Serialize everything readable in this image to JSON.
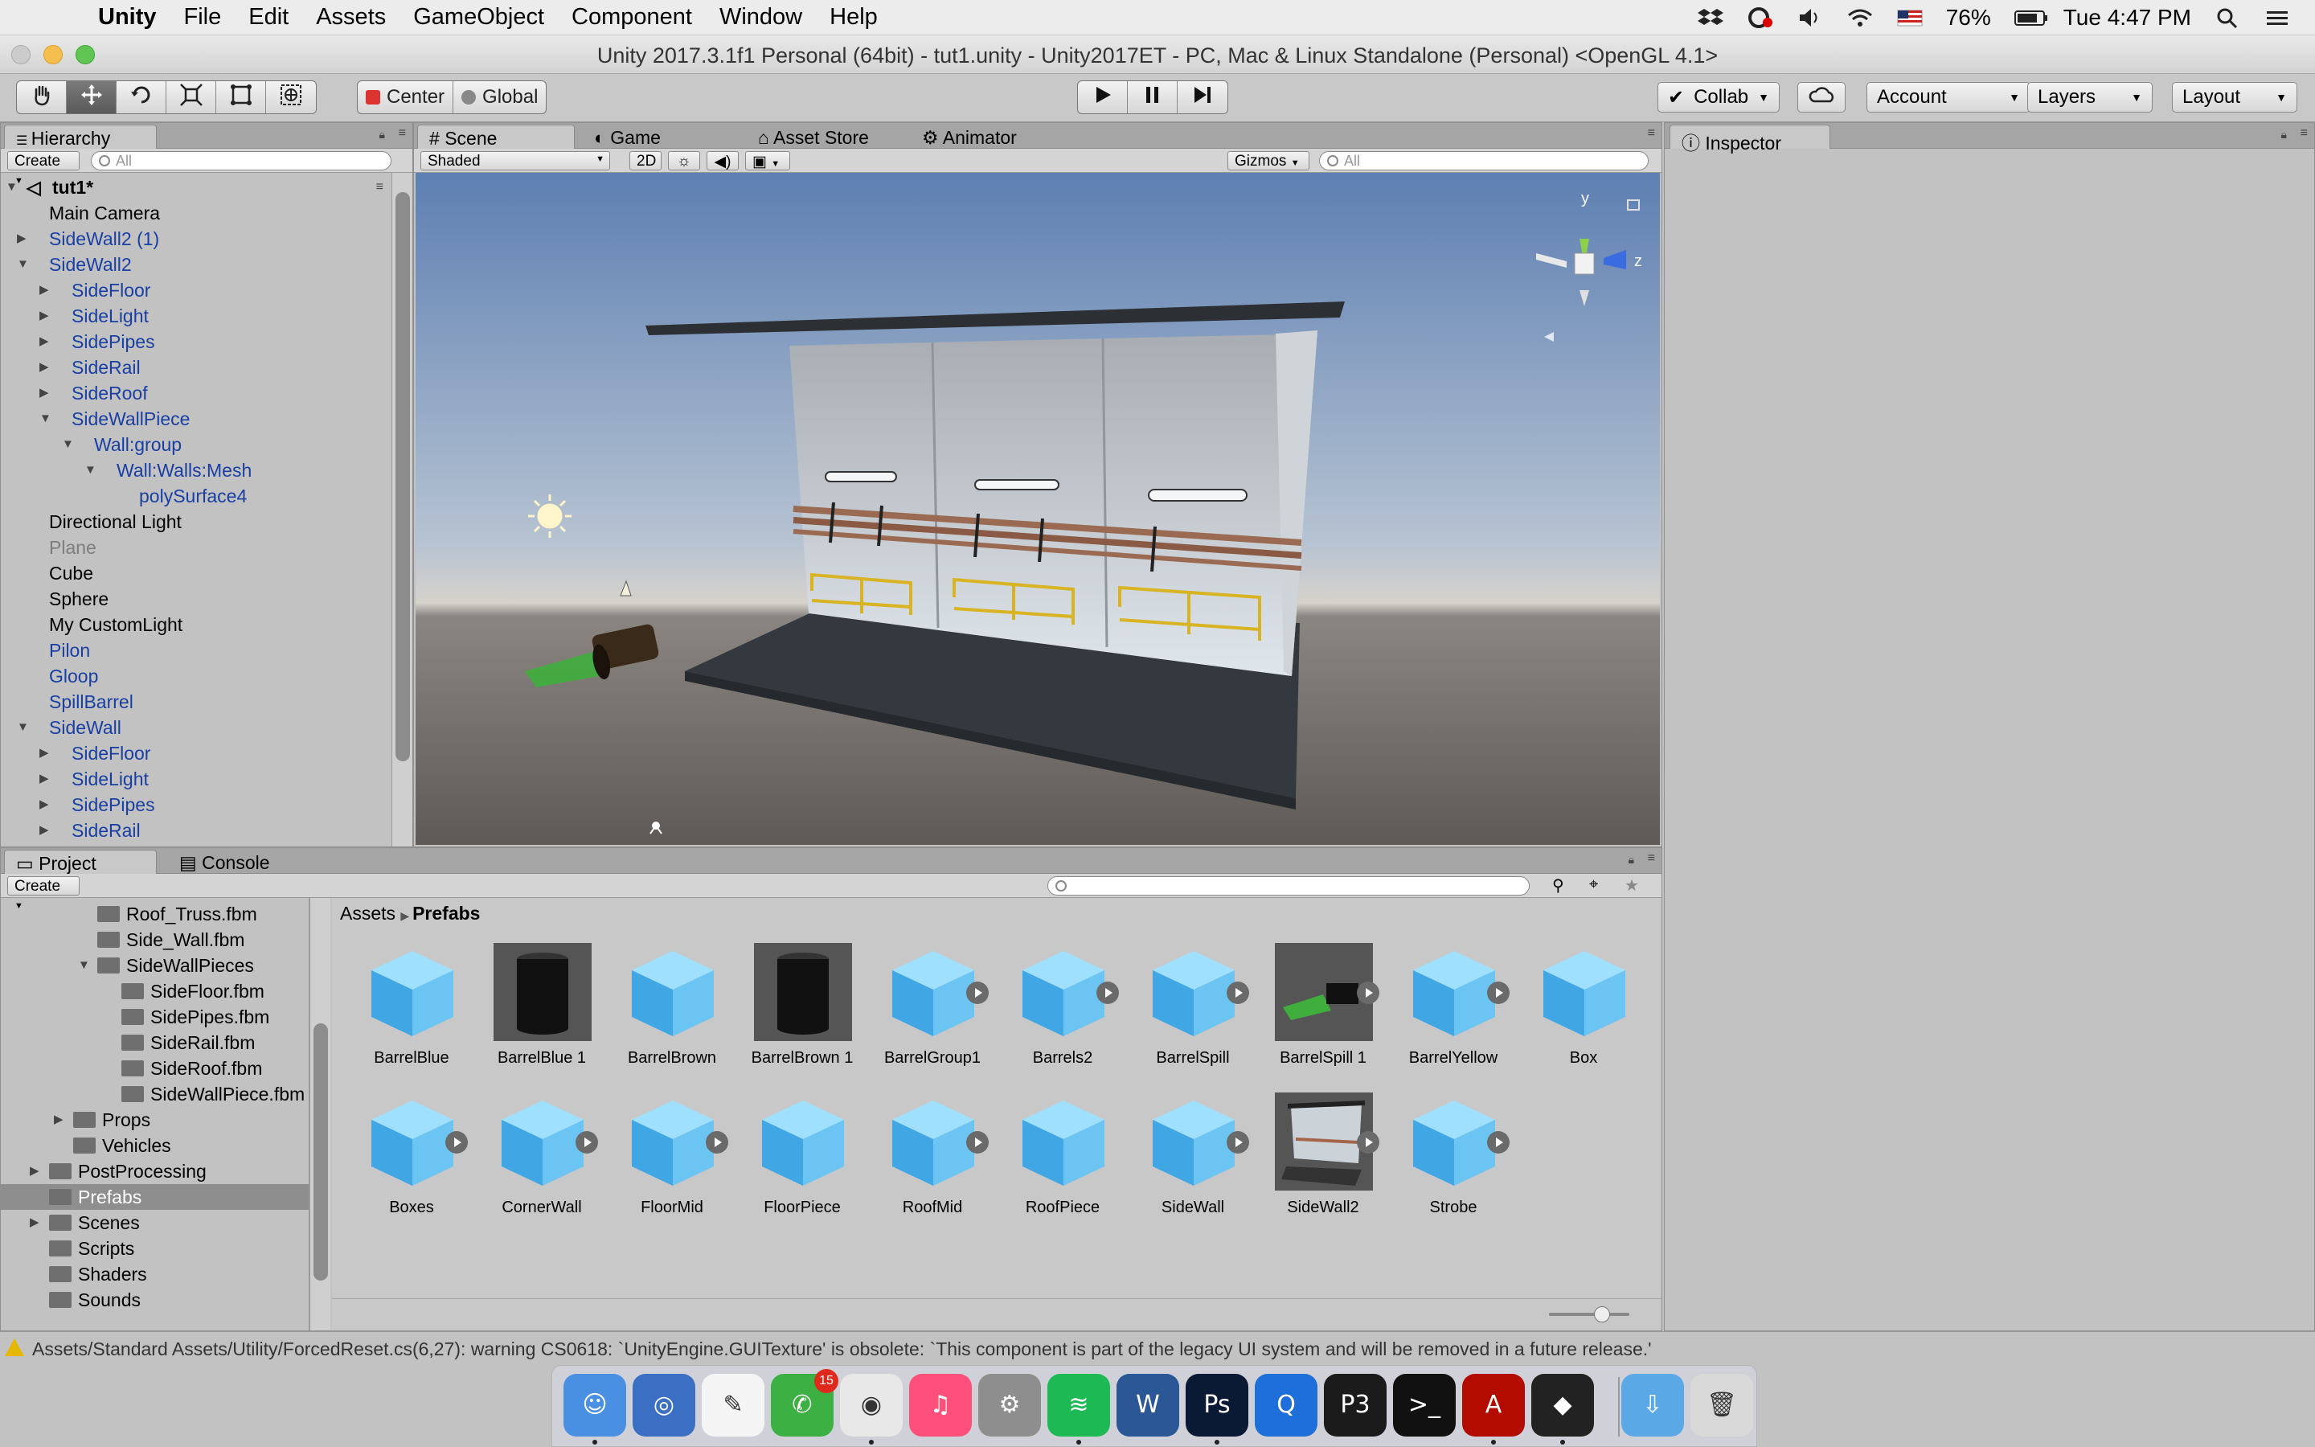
{
  "menubar": {
    "app_name": "Unity",
    "menus": [
      "File",
      "Edit",
      "Assets",
      "GameObject",
      "Component",
      "Window",
      "Help"
    ],
    "battery": "76%",
    "clock": "Tue 4:47 PM"
  },
  "window": {
    "title": "Unity 2017.3.1f1 Personal (64bit) - tut1.unity - Unity2017ET - PC, Mac & Linux Standalone (Personal) <OpenGL 4.1>"
  },
  "toolbar": {
    "pivot_center": "Center",
    "pivot_global": "Global",
    "collab": "Collab",
    "account": "Account",
    "layers": "Layers",
    "layout": "Layout"
  },
  "hierarchy": {
    "tab": "Hierarchy",
    "create": "Create",
    "search_placeholder": "All",
    "scene_name": "tut1*",
    "items": [
      {
        "label": "Main Camera",
        "indent": 0,
        "style": "black",
        "arrow": ""
      },
      {
        "label": "SideWall2 (1)",
        "indent": 0,
        "style": "blue",
        "arrow": "▶"
      },
      {
        "label": "SideWall2",
        "indent": 0,
        "style": "blue",
        "arrow": "▼"
      },
      {
        "label": "SideFloor",
        "indent": 1,
        "style": "blue",
        "arrow": "▶"
      },
      {
        "label": "SideLight",
        "indent": 1,
        "style": "blue",
        "arrow": "▶"
      },
      {
        "label": "SidePipes",
        "indent": 1,
        "style": "blue",
        "arrow": "▶"
      },
      {
        "label": "SideRail",
        "indent": 1,
        "style": "blue",
        "arrow": "▶"
      },
      {
        "label": "SideRoof",
        "indent": 1,
        "style": "blue",
        "arrow": "▶"
      },
      {
        "label": "SideWallPiece",
        "indent": 1,
        "style": "blue",
        "arrow": "▼"
      },
      {
        "label": "Wall:group",
        "indent": 2,
        "style": "blue",
        "arrow": "▼"
      },
      {
        "label": "Wall:Walls:Mesh",
        "indent": 3,
        "style": "blue",
        "arrow": "▼"
      },
      {
        "label": "polySurface4",
        "indent": 4,
        "style": "blue",
        "arrow": ""
      },
      {
        "label": "Directional Light",
        "indent": 0,
        "style": "black",
        "arrow": ""
      },
      {
        "label": "Plane",
        "indent": 0,
        "style": "gray",
        "arrow": ""
      },
      {
        "label": "Cube",
        "indent": 0,
        "style": "black",
        "arrow": ""
      },
      {
        "label": "Sphere",
        "indent": 0,
        "style": "black",
        "arrow": ""
      },
      {
        "label": "My CustomLight",
        "indent": 0,
        "style": "black",
        "arrow": ""
      },
      {
        "label": "Pilon",
        "indent": 0,
        "style": "blue",
        "arrow": ""
      },
      {
        "label": "Gloop",
        "indent": 0,
        "style": "blue",
        "arrow": ""
      },
      {
        "label": "SpillBarrel",
        "indent": 0,
        "style": "blue",
        "arrow": ""
      },
      {
        "label": "SideWall",
        "indent": 0,
        "style": "blue",
        "arrow": "▼"
      },
      {
        "label": "SideFloor",
        "indent": 1,
        "style": "blue",
        "arrow": "▶"
      },
      {
        "label": "SideLight",
        "indent": 1,
        "style": "blue",
        "arrow": "▶"
      },
      {
        "label": "SidePipes",
        "indent": 1,
        "style": "blue",
        "arrow": "▶"
      },
      {
        "label": "SideRail",
        "indent": 1,
        "style": "blue",
        "arrow": "▶"
      }
    ]
  },
  "scene": {
    "tabs": [
      "Scene",
      "Game",
      "Asset Store",
      "Animator"
    ],
    "shading": "Shaded",
    "mode_2d": "2D",
    "gizmos": "Gizmos",
    "search_placeholder": "All",
    "axis_y": "y",
    "axis_z": "z"
  },
  "inspector": {
    "tab": "Inspector"
  },
  "project": {
    "tabs": [
      "Project",
      "Console"
    ],
    "create": "Create",
    "breadcrumb_root": "Assets",
    "breadcrumb_current": "Prefabs",
    "folders": [
      {
        "label": "Roof_Truss.fbm",
        "indent": 3,
        "arrow": ""
      },
      {
        "label": "Side_Wall.fbm",
        "indent": 3,
        "arrow": ""
      },
      {
        "label": "SideWallPieces",
        "indent": 3,
        "arrow": "▼"
      },
      {
        "label": "SideFloor.fbm",
        "indent": 4,
        "arrow": ""
      },
      {
        "label": "SidePipes.fbm",
        "indent": 4,
        "arrow": ""
      },
      {
        "label": "SideRail.fbm",
        "indent": 4,
        "arrow": ""
      },
      {
        "label": "SideRoof.fbm",
        "indent": 4,
        "arrow": ""
      },
      {
        "label": "SideWallPiece.fbm",
        "indent": 4,
        "arrow": ""
      },
      {
        "label": "Props",
        "indent": 2,
        "arrow": "▶"
      },
      {
        "label": "Vehicles",
        "indent": 2,
        "arrow": ""
      },
      {
        "label": "PostProcessing",
        "indent": 1,
        "arrow": "▶"
      },
      {
        "label": "Prefabs",
        "indent": 1,
        "arrow": "",
        "selected": true
      },
      {
        "label": "Scenes",
        "indent": 1,
        "arrow": "▶"
      },
      {
        "label": "Scripts",
        "indent": 1,
        "arrow": ""
      },
      {
        "label": "Shaders",
        "indent": 1,
        "arrow": ""
      },
      {
        "label": "Sounds",
        "indent": 1,
        "arrow": ""
      }
    ],
    "assets": [
      {
        "label": "BarrelBlue",
        "kind": "cube",
        "play": false
      },
      {
        "label": "BarrelBlue 1",
        "kind": "barrel",
        "play": false
      },
      {
        "label": "BarrelBrown",
        "kind": "cube",
        "play": false
      },
      {
        "label": "BarrelBrown 1",
        "kind": "barrel",
        "play": false
      },
      {
        "label": "BarrelGroup1",
        "kind": "cube",
        "play": true
      },
      {
        "label": "Barrels2",
        "kind": "cube",
        "play": true
      },
      {
        "label": "BarrelSpill",
        "kind": "cube",
        "play": true
      },
      {
        "label": "BarrelSpill 1",
        "kind": "spill",
        "play": true
      },
      {
        "label": "BarrelYellow",
        "kind": "cube",
        "play": true
      },
      {
        "label": "Box",
        "kind": "cube",
        "play": false
      },
      {
        "label": "Boxes",
        "kind": "cube",
        "play": true
      },
      {
        "label": "CornerWall",
        "kind": "cube",
        "play": true
      },
      {
        "label": "FloorMid",
        "kind": "cube",
        "play": true
      },
      {
        "label": "FloorPiece",
        "kind": "cube",
        "play": false
      },
      {
        "label": "RoofMid",
        "kind": "cube",
        "play": true
      },
      {
        "label": "RoofPiece",
        "kind": "cube",
        "play": false
      },
      {
        "label": "SideWall",
        "kind": "cube",
        "play": true
      },
      {
        "label": "SideWall2",
        "kind": "wall",
        "play": true
      },
      {
        "label": "Strobe",
        "kind": "cube",
        "play": true
      }
    ]
  },
  "status": {
    "message": "Assets/Standard Assets/Utility/ForcedReset.cs(6,27): warning CS0618: `UnityEngine.GUITexture' is obsolete: `This component is part of the legacy UI system and will be removed in a future release.'"
  },
  "dock": {
    "facetime_badge": "15",
    "apps": [
      "finder-icon",
      "safari-icon",
      "textedit-icon",
      "facetime-icon",
      "chrome-icon",
      "itunes-icon",
      "system-preferences-icon",
      "spotify-icon",
      "word-icon",
      "photoshop-icon",
      "quicktime-icon",
      "p3-icon",
      "terminal-icon",
      "acrobat-icon",
      "unity-icon",
      "downloads-folder-icon",
      "trash-icon"
    ],
    "app_glyphs": [
      "☺",
      "◎",
      "✎",
      "✆",
      "◉",
      "♫",
      "⚙",
      "≋",
      "W",
      "Ps",
      "Q",
      "P3",
      ">_",
      "A",
      "◆",
      "⇩",
      "🗑"
    ],
    "colors": [
      "#4a90e2",
      "#3a6fc4",
      "#f4f4f4",
      "#3cb043",
      "#e8e8e8",
      "#ff4f7b",
      "#8e8e8e",
      "#1db954",
      "#2b5797",
      "#0a1a35",
      "#1e6fd9",
      "#1b1b1b",
      "#111111",
      "#b30b00",
      "#222222",
      "#5aa9e6",
      "#d9d9d9"
    ]
  }
}
